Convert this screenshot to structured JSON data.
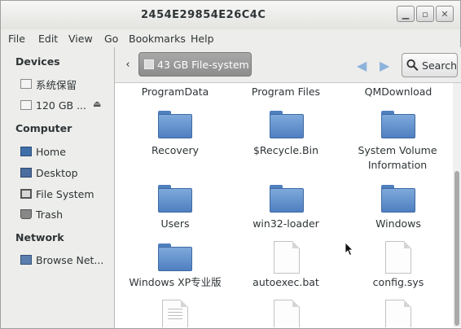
{
  "window": {
    "title": "2454E29854E26C4C"
  },
  "menu": [
    "File",
    "Edit",
    "View",
    "Go",
    "Bookmarks",
    "Help"
  ],
  "sidebar": {
    "devices_heading": "Devices",
    "devices": [
      {
        "label": "系统保留",
        "icon": "drive-icon"
      },
      {
        "label": "120 GB ...",
        "icon": "drive-icon"
      }
    ],
    "computer_heading": "Computer",
    "computer": [
      {
        "label": "Home",
        "icon": "home-icon"
      },
      {
        "label": "Desktop",
        "icon": "desktop-icon"
      },
      {
        "label": "File System",
        "icon": "filesystem-icon"
      },
      {
        "label": "Trash",
        "icon": "trash-icon"
      }
    ],
    "network_heading": "Network",
    "network": [
      {
        "label": "Browse Net...",
        "icon": "network-icon"
      }
    ]
  },
  "toolbar": {
    "path_label": "43 GB File-system",
    "search_label": "Search"
  },
  "files": [
    {
      "name": "ProgramData",
      "type": "folder"
    },
    {
      "name": "Program Files",
      "type": "folder"
    },
    {
      "name": "QMDownload",
      "type": "folder"
    },
    {
      "name": "Recovery",
      "type": "folder"
    },
    {
      "name": "$Recycle.Bin",
      "type": "folder"
    },
    {
      "name": "System Volume Information",
      "type": "folder"
    },
    {
      "name": "Users",
      "type": "folder"
    },
    {
      "name": "win32-loader",
      "type": "folder"
    },
    {
      "name": "Windows",
      "type": "folder"
    },
    {
      "name": "Windows XP专业版",
      "type": "folder"
    },
    {
      "name": "autoexec.bat",
      "type": "file"
    },
    {
      "name": "config.sys",
      "type": "file"
    },
    {
      "name": "",
      "type": "file"
    },
    {
      "name": "",
      "type": "file"
    },
    {
      "name": "",
      "type": "file"
    }
  ],
  "colors": {
    "path_button": "#9b9b9b",
    "folder": "#5b8ccc",
    "nav_arrow": "#8db3dc"
  }
}
